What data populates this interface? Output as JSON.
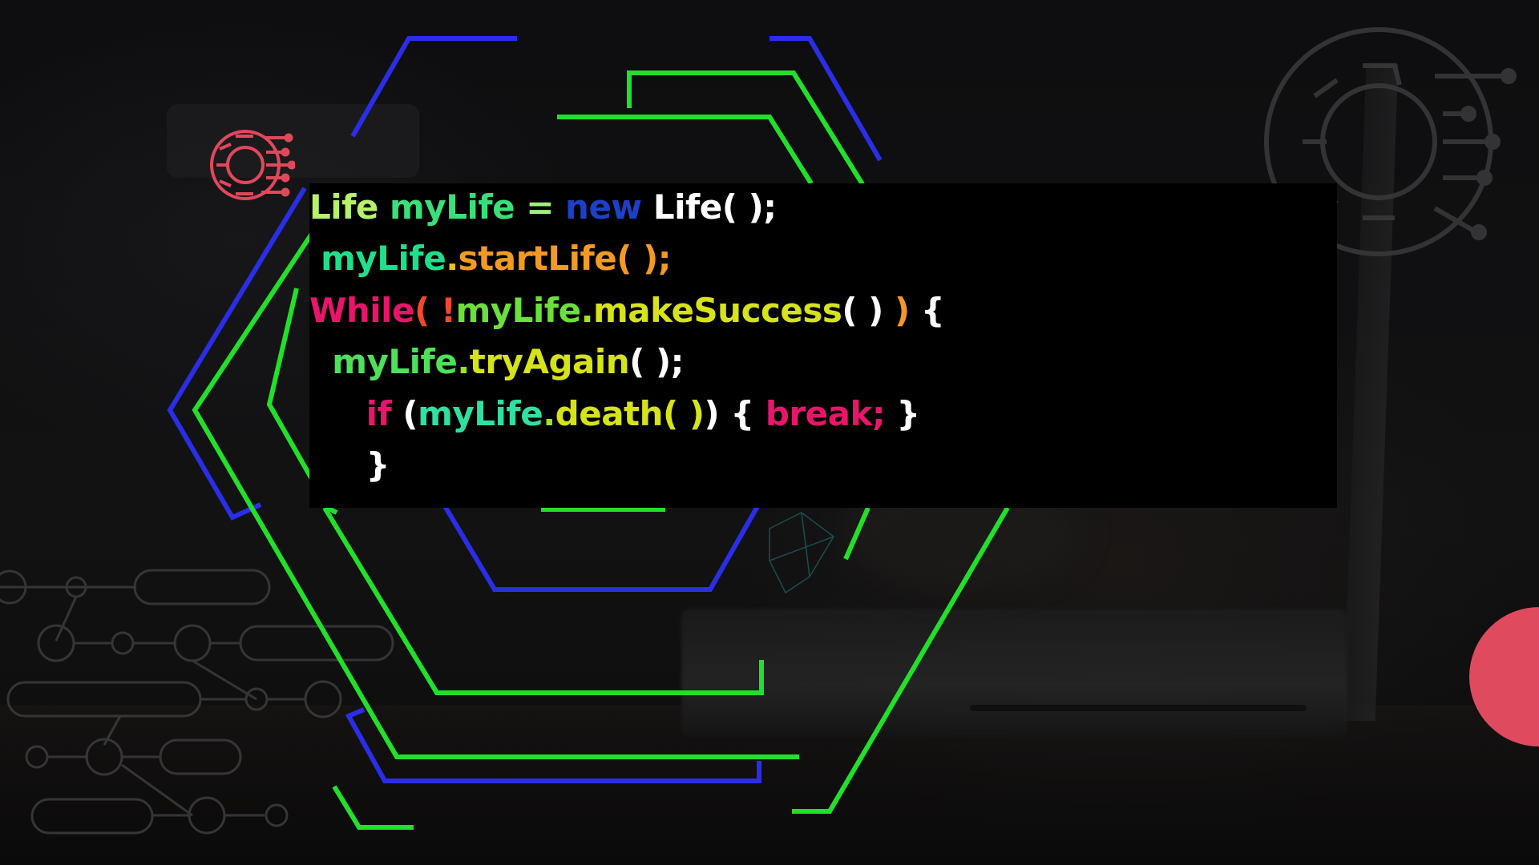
{
  "code": {
    "lines": [
      {
        "indent": "",
        "tokens": [
          {
            "text": "Life ",
            "color": "#b6f26a"
          },
          {
            "text": "myLife",
            "color": "#39e07a"
          },
          {
            "text": " = ",
            "color": "#9ef07c"
          },
          {
            "text": "new",
            "color": "#1d40c8"
          },
          {
            "text": " Life( );",
            "color": "#ffffff"
          }
        ]
      },
      {
        "indent": " ",
        "tokens": [
          {
            "text": "myLife",
            "color": "#1fe08a"
          },
          {
            "text": ".",
            "color": "#e9c21a"
          },
          {
            "text": "startLife( );",
            "color": "#f29a24"
          }
        ]
      },
      {
        "indent": "",
        "tokens": [
          {
            "text": "While",
            "color": "#e8166a"
          },
          {
            "text": "( !",
            "color": "#ef4a2a"
          },
          {
            "text": "myLife",
            "color": "#6be03a"
          },
          {
            "text": ".",
            "color": "#a8e020"
          },
          {
            "text": "makeSuccess",
            "color": "#d6e21a"
          },
          {
            "text": "( ) ",
            "color": "#ffffff"
          },
          {
            "text": ")",
            "color": "#f29a24"
          },
          {
            "text": " {",
            "color": "#ffffff"
          }
        ]
      },
      {
        "indent": "  ",
        "tokens": [
          {
            "text": "myLife",
            "color": "#4fe05a"
          },
          {
            "text": ".",
            "color": "#9fe02a"
          },
          {
            "text": "tryAgain",
            "color": "#d6e21a"
          },
          {
            "text": "( );",
            "color": "#ffffff"
          }
        ]
      },
      {
        "indent": "     ",
        "tokens": [
          {
            "text": "if ",
            "color": "#e8166a"
          },
          {
            "text": "(",
            "color": "#ffffff"
          },
          {
            "text": "myLife",
            "color": "#2fe0a0"
          },
          {
            "text": ".",
            "color": "#9fe02a"
          },
          {
            "text": "death( )",
            "color": "#d6e21a"
          },
          {
            "text": ") { ",
            "color": "#ffffff"
          },
          {
            "text": "break;",
            "color": "#e8166a"
          },
          {
            "text": " }",
            "color": "#ffffff"
          }
        ]
      },
      {
        "indent": "     ",
        "tokens": [
          {
            "text": "}",
            "color": "#ffffff"
          }
        ]
      }
    ]
  },
  "colors": {
    "hex_blue": "#2a2ee6",
    "hex_green": "#22e02a",
    "accent_red": "#e04a5f",
    "logo_red": "#e0485c"
  },
  "icons": {
    "logo": "gear-circuit-logo-icon",
    "background_gear": "gear-circuit-icon",
    "circuit_pattern": "circuit-node-pattern"
  }
}
